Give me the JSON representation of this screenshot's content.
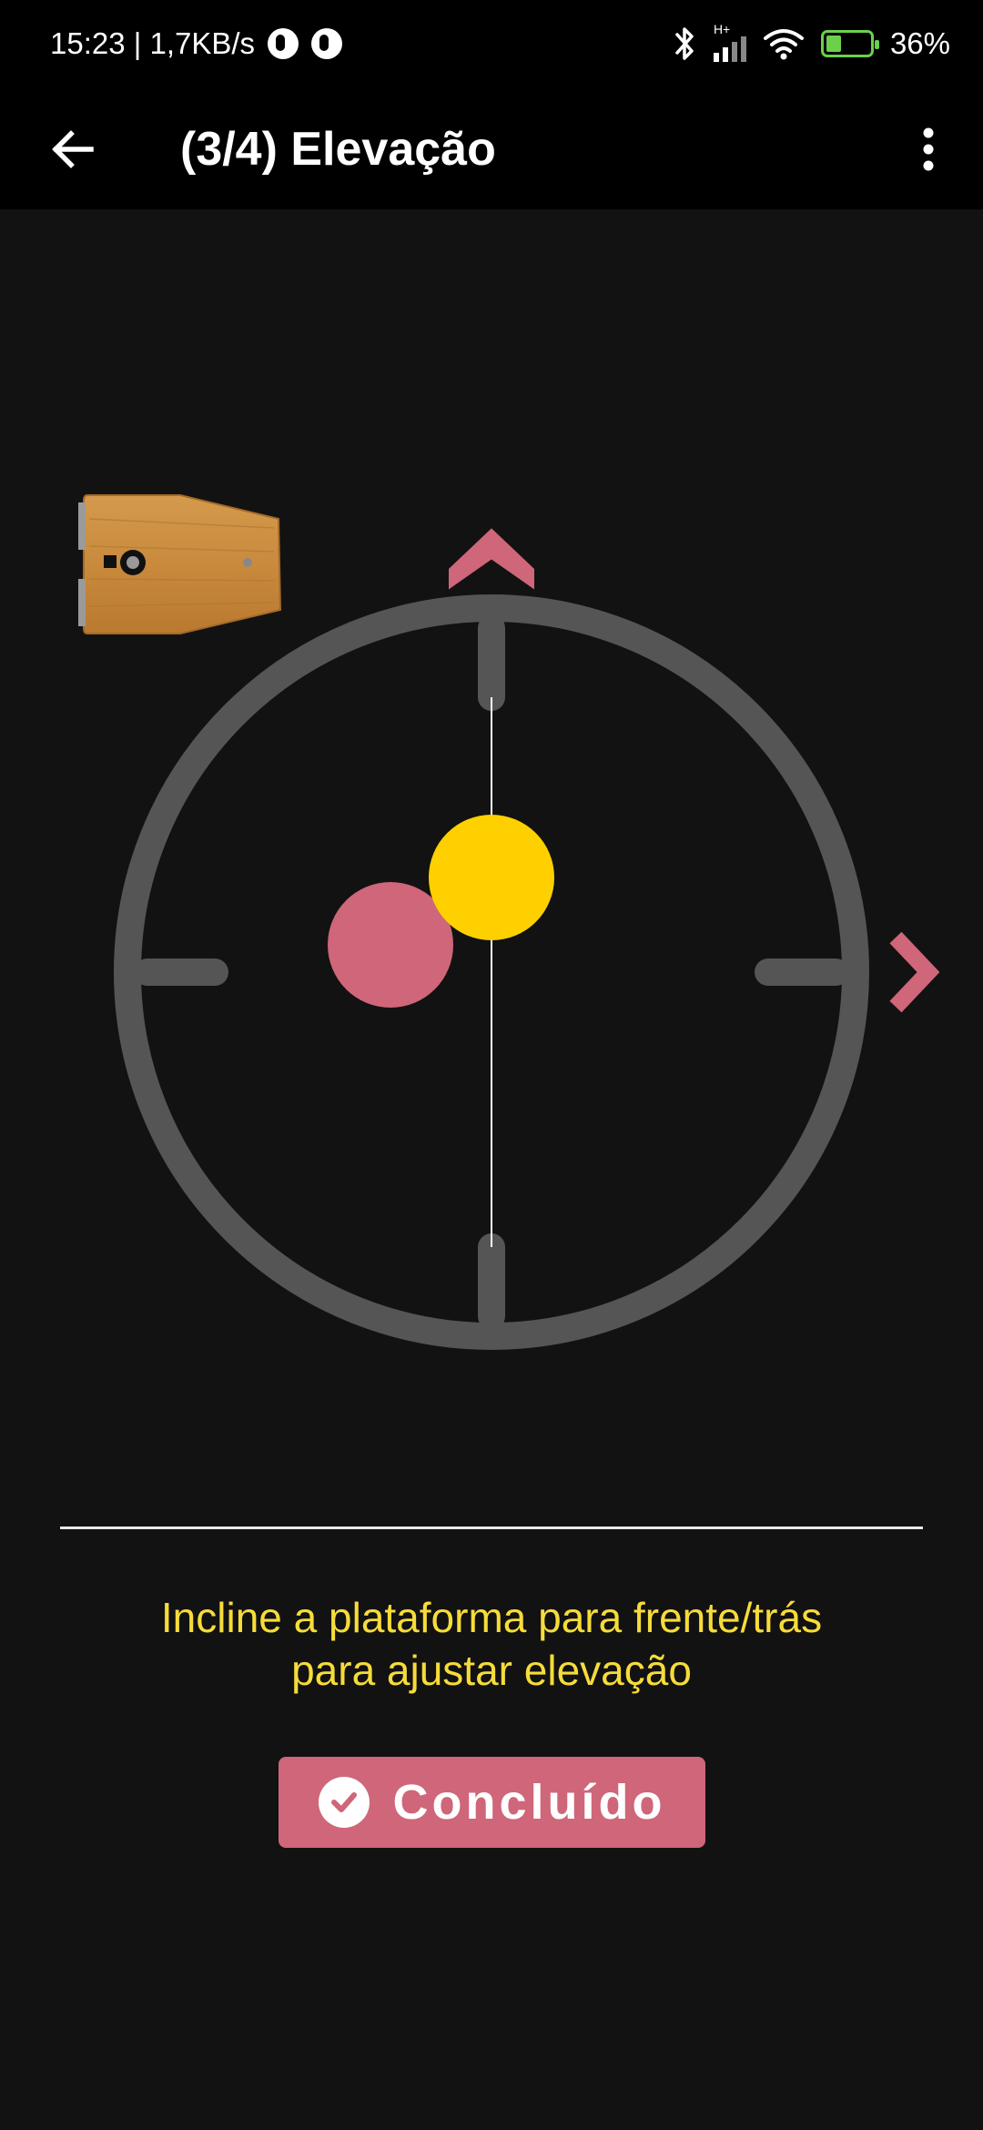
{
  "status_bar": {
    "time_speed": "15:23 | 1,7KB/s",
    "network_type": "H+",
    "battery_percent": "36%",
    "icons": [
      "notification-icon",
      "notification-icon",
      "bluetooth-icon",
      "signal-icon",
      "wifi-icon",
      "battery-charging-icon"
    ]
  },
  "app_bar": {
    "title": "(3/4) Elevação",
    "back_icon": "arrow-left-icon",
    "menu_icon": "more-vertical-icon"
  },
  "gauge": {
    "ring_color": "#555555",
    "target_color": "#cf6679",
    "indicator_color": "#ffd000",
    "arrow_color": "#cf6679",
    "arrows": [
      "chevron-up-icon",
      "chevron-right-icon"
    ]
  },
  "instruction": {
    "line1": "Incline a plataforma para frente/trás",
    "line2": "para ajustar elevação",
    "color": "#f6dc3a"
  },
  "done_button": {
    "label": "Concluído",
    "icon": "check-circle-icon",
    "color": "#cf6679"
  }
}
